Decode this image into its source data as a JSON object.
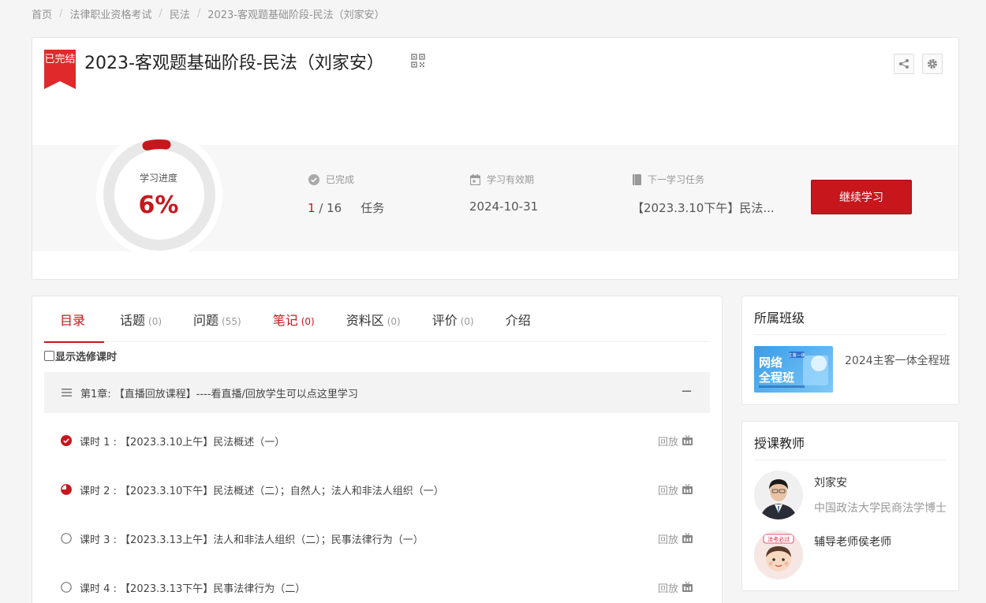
{
  "breadcrumb": {
    "items": [
      "首页",
      "法律职业资格考试",
      "民法",
      "2023-客观题基础阶段-民法（刘家安）"
    ],
    "separator": "/"
  },
  "course": {
    "status_ribbon": "已完结",
    "title": "2023-客观题基础阶段-民法（刘家安）",
    "progress_label": "学习进度",
    "progress_percent": 6,
    "progress_text": "6%",
    "completed_label": "已完成",
    "completed_done": "1",
    "completed_total": " / 16",
    "completed_unit": "任务",
    "validity_label": "学习有效期",
    "validity_value": "2024-10-31",
    "next_task_label": "下一学习任务",
    "next_task_value": "【2023.3.10下午】民法...",
    "continue_label": "继续学习",
    "accent_color": "#c8161d"
  },
  "tabs": [
    {
      "label": "目录",
      "count": ""
    },
    {
      "label": "话题",
      "count": "(0)"
    },
    {
      "label": "问题",
      "count": "(55)"
    },
    {
      "label": "笔记",
      "count": "(0)"
    },
    {
      "label": "资料区",
      "count": "(0)"
    },
    {
      "label": "评价",
      "count": "(0)"
    },
    {
      "label": "介绍",
      "count": ""
    }
  ],
  "elective_label": "显示选修课时",
  "chapter": {
    "title": "第1章: 【直播回放课程】----看直播/回放学生可以点这里学习",
    "collapse_symbol": "−"
  },
  "lessons": [
    {
      "title": "课时 1 : 【2023.3.10上午】民法概述（一）",
      "status": "completed",
      "replay": "回放"
    },
    {
      "title": "课时 2 : 【2023.3.10下午】民法概述（二）；自然人；法人和非法人组织（一）",
      "status": "in-progress",
      "replay": "回放"
    },
    {
      "title": "课时 3 : 【2023.3.13上午】法人和非法人组织（二）；民事法律行为（一）",
      "status": "not-started",
      "replay": "回放"
    },
    {
      "title": "课时 4 : 【2023.3.13下午】民事法律行为（二）",
      "status": "not-started",
      "replay": "回放"
    }
  ],
  "class_section": {
    "title": "所属班级",
    "class_name": "2024主客一体全程班",
    "thumb_text_top": "网络",
    "thumb_text_bottom": "全程班",
    "thumb_badge": "主客一体"
  },
  "teacher_section": {
    "title": "授课教师",
    "teachers": [
      {
        "name": "刘家安",
        "title": "中国政法大学民商法学博士"
      },
      {
        "name": "辅导老师侯老师",
        "title": ""
      }
    ],
    "avatar2_text": "法考必过"
  }
}
